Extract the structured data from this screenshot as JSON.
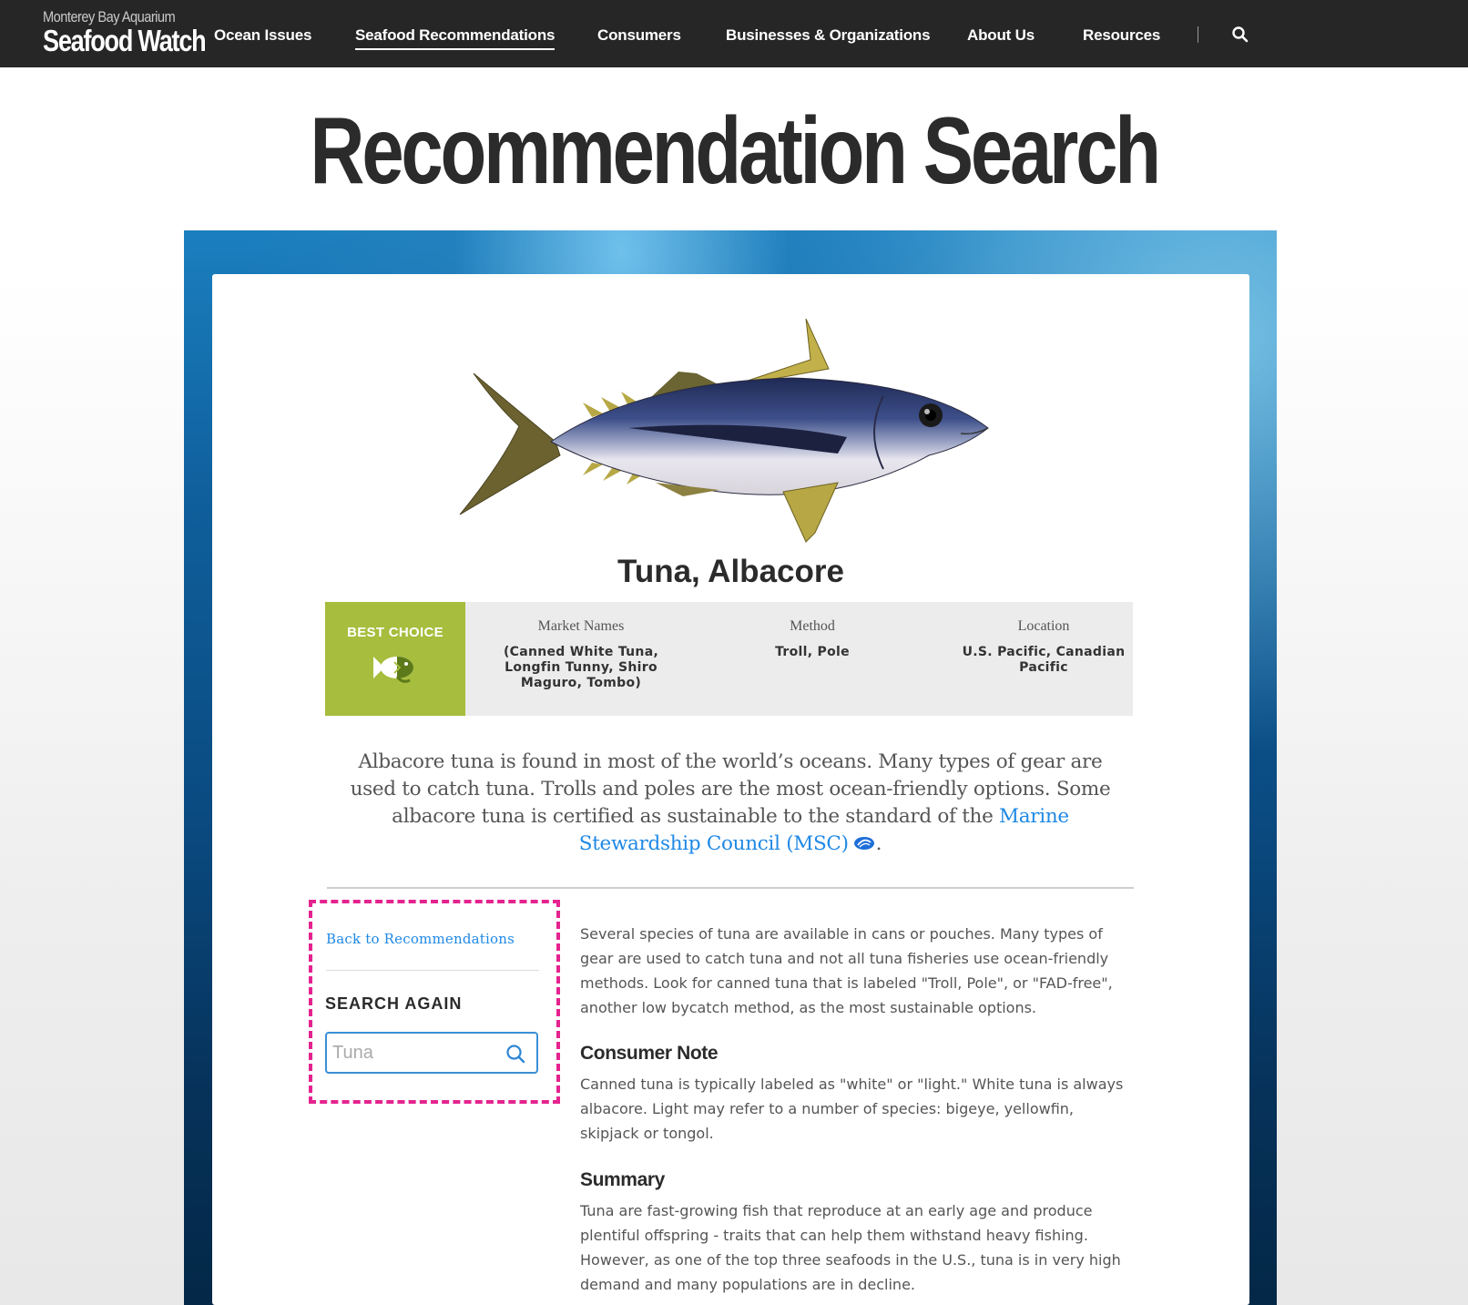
{
  "nav": {
    "logo_top": "Monterey Bay Aquarium",
    "logo_main": "Seafood Watch",
    "links": [
      {
        "label": "Ocean Issues"
      },
      {
        "label": "Seafood Recommendations",
        "active": true
      },
      {
        "label": "Consumers"
      },
      {
        "label": "Businesses & Organizations"
      },
      {
        "label": "About Us"
      },
      {
        "label": "Resources"
      }
    ],
    "search_icon": "search-icon"
  },
  "page": {
    "title": "Recommendation Search"
  },
  "species": {
    "name": "Tuna, Albacore",
    "image_icon": "albacore-tuna-illustration",
    "rating": {
      "label": "BEST CHOICE",
      "color": "#a6bd3d",
      "icon": "fish-icon"
    },
    "columns": [
      {
        "label": "Market Names",
        "value": "(Canned White Tuna, Longfin Tunny, Shiro Maguro, Tombo)"
      },
      {
        "label": "Method",
        "value": "Troll, Pole"
      },
      {
        "label": "Location",
        "value": "U.S. Pacific, Canadian Pacific"
      }
    ],
    "intro_text": "Albacore tuna is found in most of the world’s oceans. Many types of gear are used to catch tuna. Trolls and poles are the most ocean-friendly options. Some albacore tuna is certified as sustainable to the standard of the ",
    "intro_link": "Marine Stewardship Council (MSC)",
    "intro_end": "."
  },
  "sidebar": {
    "back_link": "Back to Recommendations",
    "search_heading": "SEARCH AGAIN",
    "search_placeholder": "Tuna"
  },
  "content": {
    "paragraph": "Several species of tuna are available in cans or pouches. Many types of gear are used to catch tuna and not all tuna fisheries use ocean-friendly methods. Look for canned tuna that is labeled \"Troll, Pole\", or \"FAD-free\", another low bycatch method, as the most sustainable options.",
    "consumer_note_heading": "Consumer Note",
    "consumer_note": "Canned tuna is typically labeled as \"white\" or \"light.\" White tuna is always albacore. Light may refer to a number of species: bigeye, yellowfin, skipjack or tongol.",
    "summary_heading": "Summary",
    "summary": "Tuna are fast-growing fish that reproduce at an early age and produce plentiful offspring - traits that can help them withstand heavy fishing. However, as one of the top three seafoods in the U.S., tuna is in very high demand and many populations are in decline."
  },
  "colors": {
    "nav_bg": "#262626",
    "link": "#1e88e5",
    "highlight_dash": "#e5238f"
  }
}
